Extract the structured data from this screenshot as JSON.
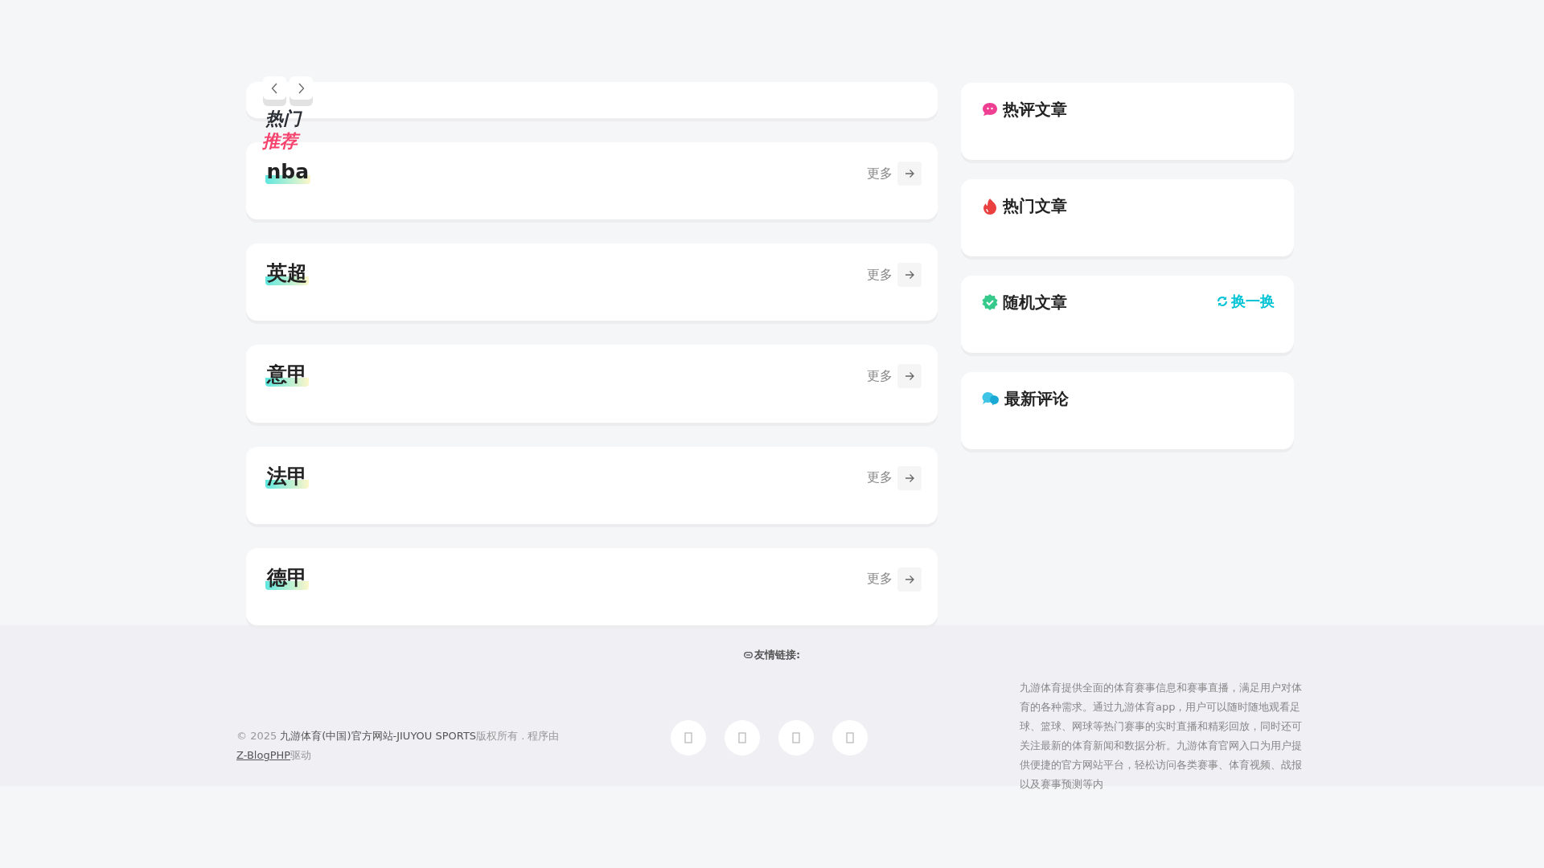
{
  "featured": {
    "title_top": "热门",
    "title_bottom": "推荐"
  },
  "sections": [
    {
      "title": "nba",
      "more": "更多"
    },
    {
      "title": "英超",
      "more": "更多"
    },
    {
      "title": "意甲",
      "more": "更多"
    },
    {
      "title": "法甲",
      "more": "更多"
    },
    {
      "title": "德甲",
      "more": "更多"
    }
  ],
  "sidebar": [
    {
      "kind": "comment",
      "title": "热评文章"
    },
    {
      "kind": "fire",
      "title": "热门文章"
    },
    {
      "kind": "badge",
      "title": "随机文章",
      "action": "换一换"
    },
    {
      "kind": "chat",
      "title": "最新评论"
    }
  ],
  "footer": {
    "links_label": "友情链接:",
    "copyright": {
      "prefix": "© 2025 ",
      "site": "九游体育(中国)官方网站-JIUYOU SPORTS",
      "middle": "版权所有 . 程序由",
      "engine": "Z-BlogPHP",
      "suffix": "驱动"
    },
    "social_buttons": [
      {
        "kind": "glyph"
      },
      {
        "kind": "glyph"
      },
      {
        "kind": "glyph"
      },
      {
        "kind": "glyph"
      }
    ],
    "about": "九游体育提供全面的体育赛事信息和赛事直播，满足用户对体育的各种需求。通过九游体育app，用户可以随时随地观看足球、篮球、网球等热门赛事的实时直播和精彩回放，同时还可关注最新的体育新闻和数据分析。九游体育官网入口为用户提供便捷的官方网站平台，轻松访问各类赛事、体育视频、战报以及赛事预测等内"
  }
}
